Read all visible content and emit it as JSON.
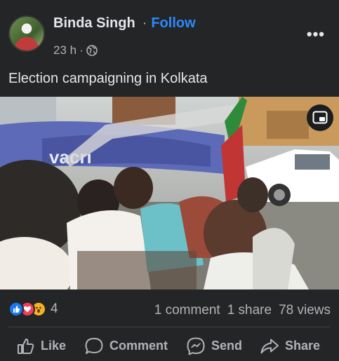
{
  "post": {
    "author": "Binda Singh",
    "dot": "·",
    "follow_label": "Follow",
    "time": "23 h",
    "time_sep": "·",
    "more_label": "•••",
    "caption": "Election campaigning in Kolkata"
  },
  "video": {
    "banner_text": "vacrı"
  },
  "stats": {
    "reactions": [
      "like-icon",
      "love-icon",
      "wow-icon"
    ],
    "reaction_count": "4",
    "comments": "1 comment",
    "shares": "1 share",
    "views": "78 views"
  },
  "actions": {
    "like": "Like",
    "comment": "Comment",
    "send": "Send",
    "share": "Share"
  },
  "colors": {
    "background": "#242526",
    "accent": "#2d88ff",
    "muted_text": "#b0b3b8"
  }
}
